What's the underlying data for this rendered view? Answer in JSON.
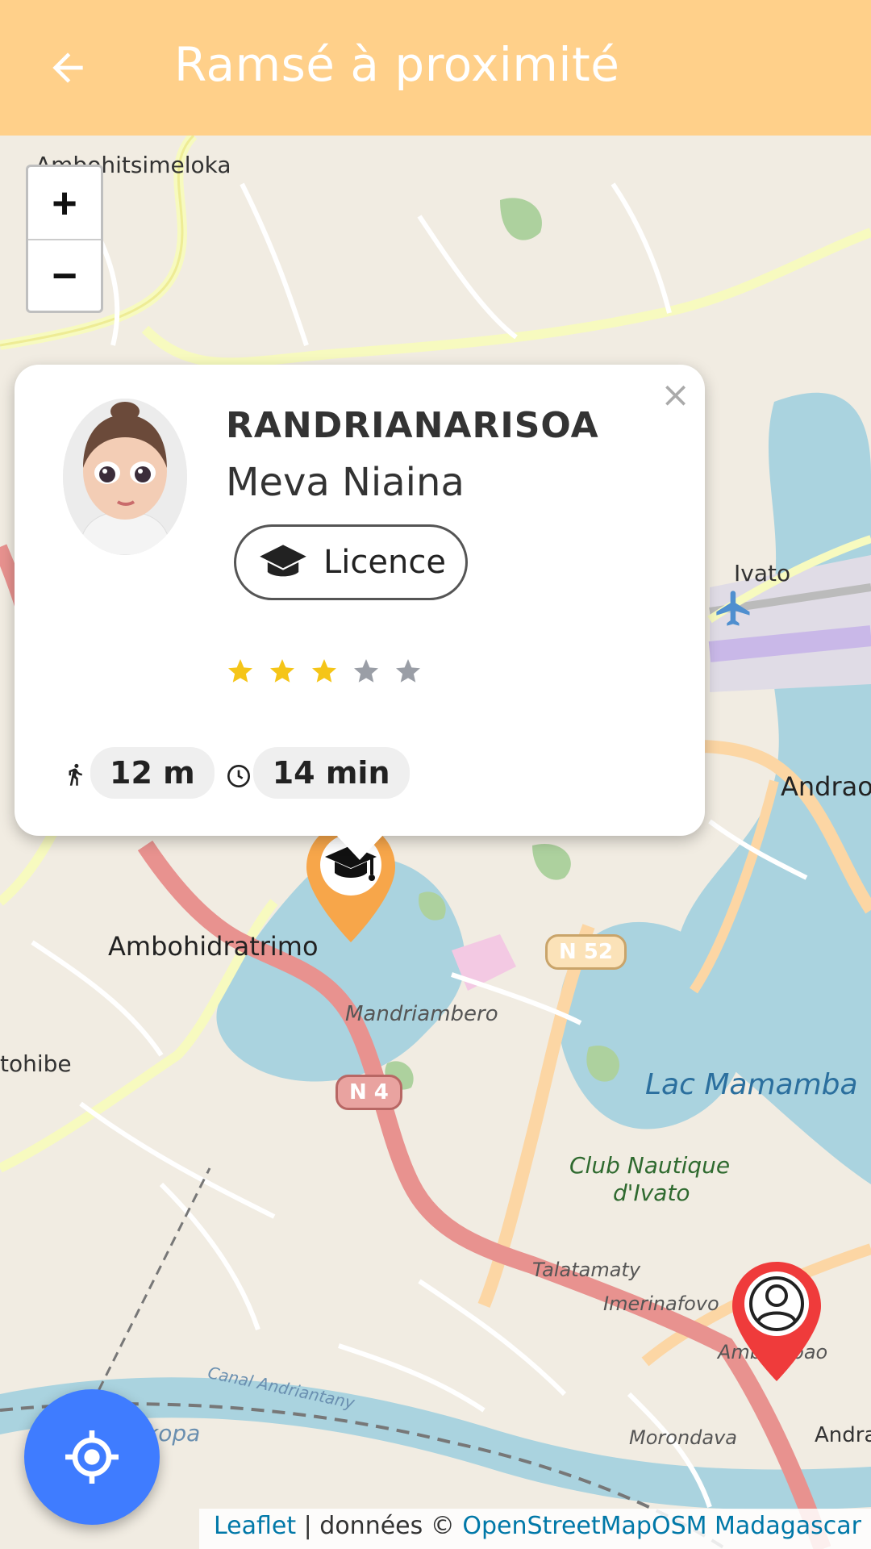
{
  "appbar": {
    "title": "Ramsé à proximité",
    "background": "#ffd08a"
  },
  "map": {
    "zoom_in_label": "+",
    "zoom_out_label": "−",
    "labels": {
      "ambohitsimeloka": "Ambohitsimeloka",
      "ivato": "Ivato",
      "andraon": "Andraon",
      "ambohidratrimo": "Ambohidratrimo",
      "mandriambero": "Mandriambero",
      "tohibe": "tohibe",
      "lac_mamamba": "Lac Mamamba",
      "club_nautique_1": "Club Nautique",
      "club_nautique_2": "d'Ivato",
      "talatamaty": "Talatamaty",
      "imerinafovo": "Imerinafovo",
      "ambohibao": "Ambohibao",
      "morondava": "Morondava",
      "andra": "Andra",
      "kopa": "kopa",
      "canal": "Canal Andriantany"
    },
    "shields": {
      "n52": "N 52",
      "n4": "N 4"
    }
  },
  "popup": {
    "close_label": "×",
    "last_name": "RANDRIANARISOA",
    "first_name": "Meva Niaina",
    "degree": "Licence",
    "degree_icon": "graduation-cap-icon",
    "rating": 3,
    "rating_max": 5,
    "star_filled_color": "#f5c518",
    "star_empty_color": "#9a9ea6",
    "distance": "12 m",
    "duration": "14 min"
  },
  "markers": {
    "student_pin_color": "#f7a64a",
    "user_pin_color": "#ef3b3b"
  },
  "locate_button": {
    "icon": "crosshair-icon",
    "color": "#3f7cff"
  },
  "attribution": {
    "leaflet": "Leaflet",
    "separator": " | données © ",
    "osm": "OpenStreetMap",
    "osm_mg": "OSM Madagascar"
  }
}
